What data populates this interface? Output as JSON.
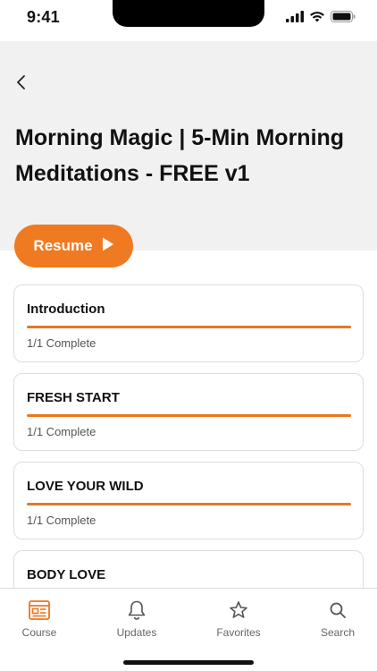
{
  "status_bar": {
    "time": "9:41"
  },
  "header": {
    "title": "Morning Magic | 5-Min Morning Meditations - FREE v1",
    "background": "#f1f1f1"
  },
  "resume_button": {
    "label": "Resume",
    "color": "#ef7a22"
  },
  "modules": [
    {
      "title": "Introduction",
      "status": "1/1 Complete",
      "progress": 1.0
    },
    {
      "title": "FRESH START",
      "status": "1/1 Complete",
      "progress": 1.0
    },
    {
      "title": "LOVE YOUR WILD",
      "status": "1/1 Complete",
      "progress": 1.0
    },
    {
      "title": "BODY LOVE",
      "status": "",
      "progress": null
    }
  ],
  "tab_bar": {
    "active": "Course",
    "accent": "#e87722",
    "tabs": [
      {
        "label": "Course",
        "icon": "course-icon"
      },
      {
        "label": "Updates",
        "icon": "bell-icon"
      },
      {
        "label": "Favorites",
        "icon": "star-icon"
      },
      {
        "label": "Search",
        "icon": "search-icon"
      }
    ]
  }
}
